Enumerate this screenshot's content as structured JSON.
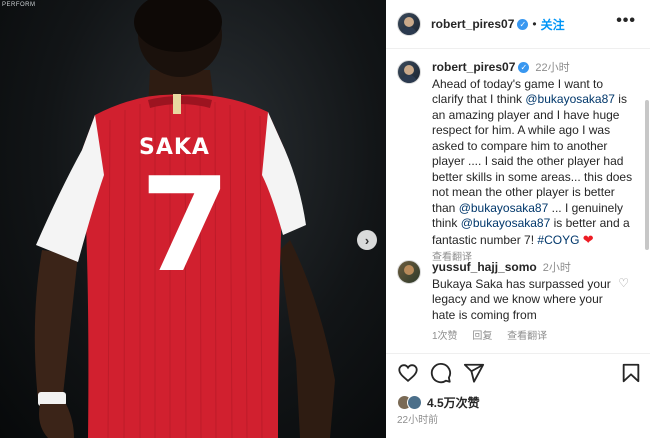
{
  "photo": {
    "watermark": "PERFORM",
    "jersey_name": "SAKA",
    "jersey_number": "7"
  },
  "header": {
    "username": "robert_pires07",
    "dot": "•",
    "follow_label": "关注",
    "more_icon": "more-horizontal-icon"
  },
  "caption": {
    "username": "robert_pires07",
    "time": "22小时",
    "text_1": "Ahead of today's game I want to clarify that I think ",
    "mention_1": "@bukayosaka87",
    "text_2": " is an amazing player and I have huge respect for him. A while ago I was asked to compare him to another player .... I said the other player had better skills in some areas... this does not mean the other player is better than ",
    "mention_2": "@bukayosaka87",
    "text_3": " ... I genuinely think ",
    "mention_3": "@bukayosaka87",
    "text_4": " is better and a fantastic number 7! ",
    "hashtag": "#COYG",
    "heart": "❤",
    "translate": "查看翻译"
  },
  "comment": {
    "username": "yussuf_hajj_somo",
    "time": "2小时",
    "text": "Bukaya Saka has surpassed your legacy and we know where your hate is coming from",
    "likes": "1次赞",
    "reply": "回复",
    "translate": "查看翻译"
  },
  "actions": {
    "likes": "4.5万次赞",
    "time_ago": "22小时前"
  },
  "colors": {
    "accent": "#0095f6",
    "link": "#00376b",
    "jersey_red": "#d1202f"
  }
}
